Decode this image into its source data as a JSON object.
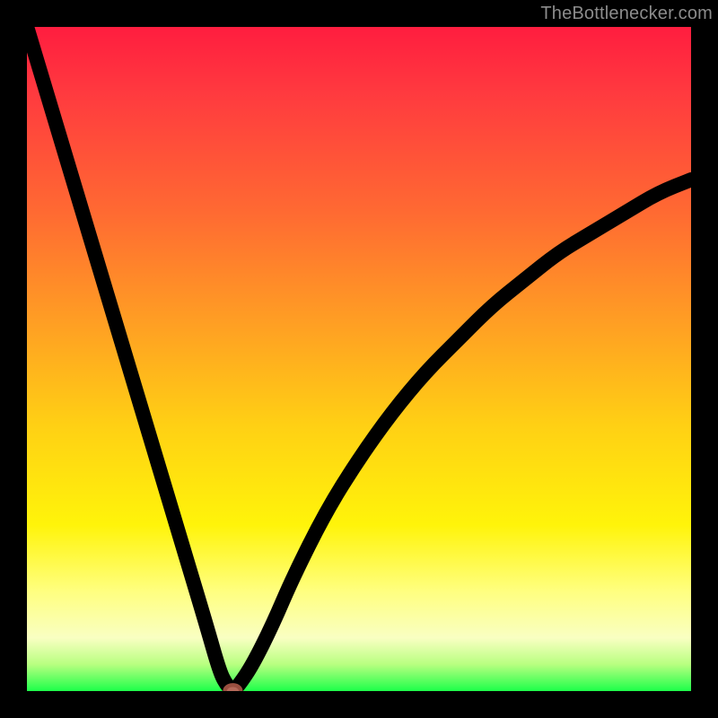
{
  "watermark": {
    "text": "TheBottlenecker.com"
  },
  "chart_data": {
    "type": "line",
    "title": "",
    "xlabel": "",
    "ylabel": "",
    "xlim": [
      0,
      100
    ],
    "ylim": [
      0,
      100
    ],
    "grid": false,
    "legend": false,
    "background": {
      "type": "vertical-gradient",
      "stops": [
        {
          "offset": 0.0,
          "color": "#ff1d3f"
        },
        {
          "offset": 0.28,
          "color": "#ff6a32"
        },
        {
          "offset": 0.6,
          "color": "#ffd014"
        },
        {
          "offset": 0.85,
          "color": "#ffff80"
        },
        {
          "offset": 1.0,
          "color": "#1dff4a"
        }
      ]
    },
    "series": [
      {
        "name": "bottleneck-curve",
        "color": "#000000",
        "x": [
          0,
          3,
          6,
          9,
          12,
          15,
          18,
          21,
          24,
          27,
          29,
          30,
          31,
          32,
          34,
          37,
          40,
          45,
          50,
          55,
          60,
          65,
          70,
          75,
          80,
          85,
          90,
          95,
          100
        ],
        "y": [
          100,
          90,
          80,
          70,
          60,
          50,
          40,
          30,
          20,
          10,
          3,
          1,
          0,
          1,
          4,
          10,
          17,
          27,
          35,
          42,
          48,
          53,
          58,
          62,
          66,
          69,
          72,
          75,
          77
        ]
      }
    ],
    "annotations": [
      {
        "type": "dot",
        "name": "minimum-marker",
        "x": 31,
        "y": 0,
        "color": "#b66a5a",
        "rx": 1.2,
        "ry": 0.9
      }
    ]
  }
}
